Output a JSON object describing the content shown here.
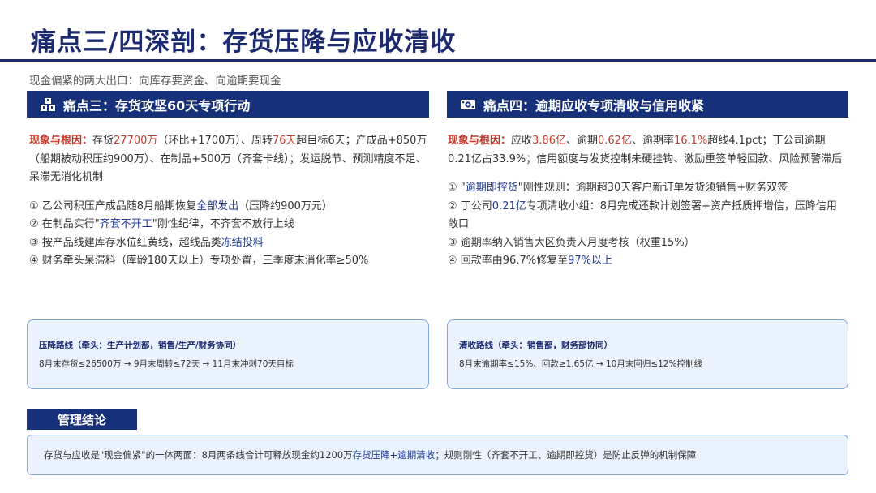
{
  "title": "痛点三/四深剖：存货压降与应收清收",
  "subtitle": "现金偏紧的两大出口：向库存要资金、向逾期要现金",
  "colors": {
    "navy": "#17307a",
    "red": "#c0392b",
    "blue": "#1f3a93",
    "box_bg": "#e9f2fd",
    "box_border": "#7ea6dd"
  },
  "left": {
    "icon": "boxes-icon",
    "header": "痛点三：存货攻坚60天专项行动",
    "cause": {
      "label": "现象与根因：",
      "t1": "存货",
      "v1": "27700万",
      "t2": "（环比+1700万）、周转",
      "v2": "76天",
      "t3": "超目标6天；产成品+850万（船期被动积压约900万）、在制品+500万（齐套卡线）；发运脱节、预测精度不足、呆滞无消化机制"
    },
    "items": [
      {
        "pre": "① 乙公司积压产成品随8月船期恢复",
        "hl": "全部发出",
        "post": "（压降约900万元）"
      },
      {
        "pre": "② 在制品实行\"",
        "hl": "齐套不开工",
        "post": "\"刚性纪律，不齐套不放行上线"
      },
      {
        "pre": "③ 按产品线建库存水位红黄线，超线品类",
        "hl": "冻结投料",
        "post": ""
      },
      {
        "pre": "④ 财务牵头呆滞料（库龄180天以上）专项处置，三季度末消化率≥50%",
        "hl": "",
        "post": ""
      }
    ],
    "route_title": "压降路线（牵头：生产计划部，销售/生产/财务协同）",
    "route_body": "8月末存货≤26500万 → 9月末周转≤72天 → 11月末冲刺70天目标"
  },
  "right": {
    "icon": "cash-icon",
    "header": "痛点四：逾期应收专项清收与信用收紧",
    "cause": {
      "label": "现象与根因：",
      "t1": "应收",
      "v1": "3.86亿",
      "t2": "、逾期",
      "v2": "0.62亿",
      "t3": "、逾期率",
      "v3": "16.1%",
      "t4": "超线4.1pct；丁公司逾期0.21亿占33.9%；信用额度与发货控制未硬挂钩、激励重签单轻回款、风险预警滞后"
    },
    "items": [
      {
        "pre": "① \"",
        "hl": "逾期即控货",
        "post": "\"刚性规则：逾期超30天客户新订单发货须销售+财务双签"
      },
      {
        "pre": "② 丁公司",
        "hl": "0.21亿",
        "post": "专项清收小组：8月完成还款计划签署+资产抵质押增信，压降信用敞口"
      },
      {
        "pre": "③ 逾期率纳入销售大区负责人月度考核（权重15%）",
        "hl": "",
        "post": ""
      },
      {
        "pre": "④ 回款率由96.7%修复至",
        "hl": "97%以上",
        "post": ""
      }
    ],
    "route_title": "清收路线（牵头：销售部，财务部协同）",
    "route_body": "8月末逾期率≤15%、回款≥1.65亿 → 10月末回归≤12%控制线"
  },
  "conclusion": {
    "header": "管理结论",
    "pre": "存货与应收是\"现金偏紧\"的一体两面：8月两条线合计可释放现金约1200万",
    "hl": "存货压降+逾期清收",
    "post": "；规则刚性（齐套不开工、逾期即控货）是防止反弹的机制保障"
  }
}
